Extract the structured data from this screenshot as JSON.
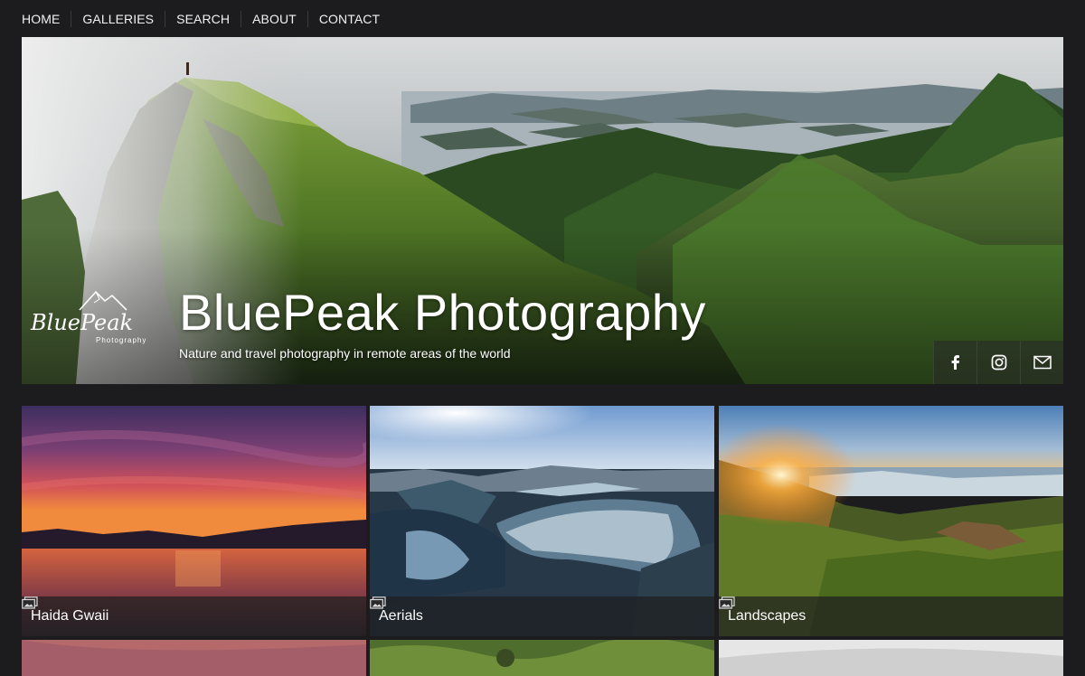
{
  "nav": {
    "items": [
      "HOME",
      "GALLERIES",
      "SEARCH",
      "ABOUT",
      "CONTACT"
    ]
  },
  "hero": {
    "title": "BluePeak Photography",
    "subtitle": "Nature and travel photography in remote areas of the world",
    "logo": {
      "word": "BluePeak",
      "tagline": "Photography"
    },
    "social": [
      "facebook-icon",
      "instagram-icon",
      "mail-icon"
    ]
  },
  "galleries": [
    {
      "label": "Haida Gwaii",
      "icon": "gallery-icon"
    },
    {
      "label": "Aerials",
      "icon": "gallery-icon"
    },
    {
      "label": "Landscapes",
      "icon": "gallery-icon"
    }
  ],
  "colors": {
    "background": "#1c1c1e",
    "caption_bar": "#1e1e20",
    "text": "#ffffff"
  }
}
